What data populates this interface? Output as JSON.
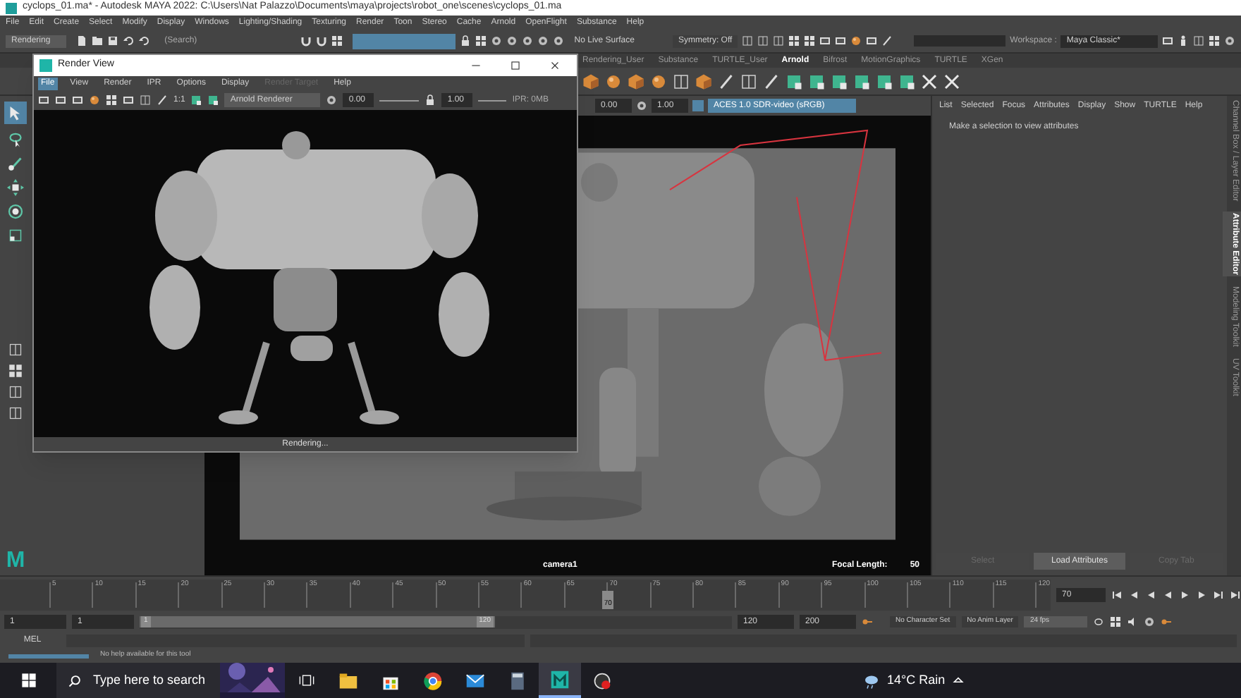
{
  "title_bar": {
    "title": "cyclops_01.ma* - Autodesk MAYA 2022: C:\\Users\\Nat Palazzo\\Documents\\maya\\projects\\robot_one\\scenes\\cyclops_01.ma"
  },
  "menu_bar": [
    "File",
    "Edit",
    "Create",
    "Select",
    "Modify",
    "Display",
    "Windows",
    "Lighting/Shading",
    "Texturing",
    "Render",
    "Toon",
    "Stereo",
    "Cache",
    "Arnold",
    "OpenFlight",
    "Substance",
    "Help"
  ],
  "status_line": {
    "menu_set": "Rendering",
    "search_placeholder": "(Search)",
    "live_surface": "No Live Surface",
    "symmetry": "Symmetry: Off",
    "workspace_label": "Workspace :",
    "workspace": "Maya Classic*"
  },
  "shelf_tabs": [
    {
      "label": "Rendering_User",
      "selected": false
    },
    {
      "label": "Substance",
      "selected": false
    },
    {
      "label": "TURTLE_User",
      "selected": false
    },
    {
      "label": "Arnold",
      "selected": true
    },
    {
      "label": "Bifrost",
      "selected": false
    },
    {
      "label": "MotionGraphics",
      "selected": false
    },
    {
      "label": "TURTLE",
      "selected": false
    },
    {
      "label": "XGen",
      "selected": false
    }
  ],
  "render_view": {
    "title": "Render View",
    "menu": [
      {
        "label": "File",
        "selected": true,
        "disabled": false
      },
      {
        "label": "View",
        "selected": false,
        "disabled": false
      },
      {
        "label": "Render",
        "selected": false,
        "disabled": false
      },
      {
        "label": "IPR",
        "selected": false,
        "disabled": false
      },
      {
        "label": "Options",
        "selected": false,
        "disabled": false
      },
      {
        "label": "Display",
        "selected": false,
        "disabled": false
      },
      {
        "label": "Render Target",
        "selected": false,
        "disabled": true
      },
      {
        "label": "Help",
        "selected": false,
        "disabled": false
      }
    ],
    "ratio": "1:1",
    "renderer": "Arnold Renderer",
    "exposure": "0.00",
    "gamma": "1.00",
    "ipr_memory": "IPR: 0MB",
    "status": "Rendering..."
  },
  "viewport": {
    "exposure": "0.00",
    "gamma": "1.00",
    "view_transform": "ACES 1.0 SDR-video (sRGB)",
    "camera": "camera1",
    "focal_label": "Focal Length:",
    "focal_value": "50"
  },
  "attribute_editor": {
    "menu": [
      "List",
      "Selected",
      "Focus",
      "Attributes",
      "Display",
      "Show",
      "TURTLE",
      "Help"
    ],
    "message": "Make a selection to view attributes",
    "buttons": [
      {
        "label": "Select",
        "disabled": true
      },
      {
        "label": "Load Attributes",
        "disabled": false
      },
      {
        "label": "Copy Tab",
        "disabled": true
      }
    ]
  },
  "side_tabs": [
    {
      "label": "Channel Box / Layer Editor",
      "selected": false
    },
    {
      "label": "Attribute Editor",
      "selected": true
    },
    {
      "label": "Modeling Toolkit",
      "selected": false
    },
    {
      "label": "UV Toolkit",
      "selected": false
    }
  ],
  "logo": "M",
  "timeline": {
    "ticks": [
      "5",
      "10",
      "15",
      "20",
      "25",
      "30",
      "35",
      "40",
      "45",
      "50",
      "55",
      "60",
      "65",
      "70",
      "75",
      "80",
      "85",
      "90",
      "95",
      "100",
      "105",
      "110",
      "115",
      "120"
    ],
    "current_frame": "70",
    "current_field": "70"
  },
  "range_slider": {
    "start": "1",
    "playback_start": "1",
    "slider_start": "1",
    "slider_end": "120",
    "playback_end": "120",
    "end": "200",
    "character_set": "No Character Set",
    "anim_layer": "No Anim Layer",
    "fps": "24 fps"
  },
  "command_line": {
    "label": "MEL"
  },
  "help_line": {
    "text": "No help available for this tool",
    "progress": {
      "level": 1
    }
  },
  "taskbar": {
    "search_placeholder": "Type here to search",
    "weather": "14°C Rain",
    "apps": [
      {
        "kind": "folder",
        "selected": false
      },
      {
        "kind": "store",
        "selected": false
      },
      {
        "kind": "browser",
        "selected": false
      },
      {
        "kind": "mail",
        "selected": false
      },
      {
        "kind": "calculator",
        "selected": false
      },
      {
        "kind": "maya",
        "selected": true
      },
      {
        "kind": "record",
        "selected": false
      }
    ]
  }
}
